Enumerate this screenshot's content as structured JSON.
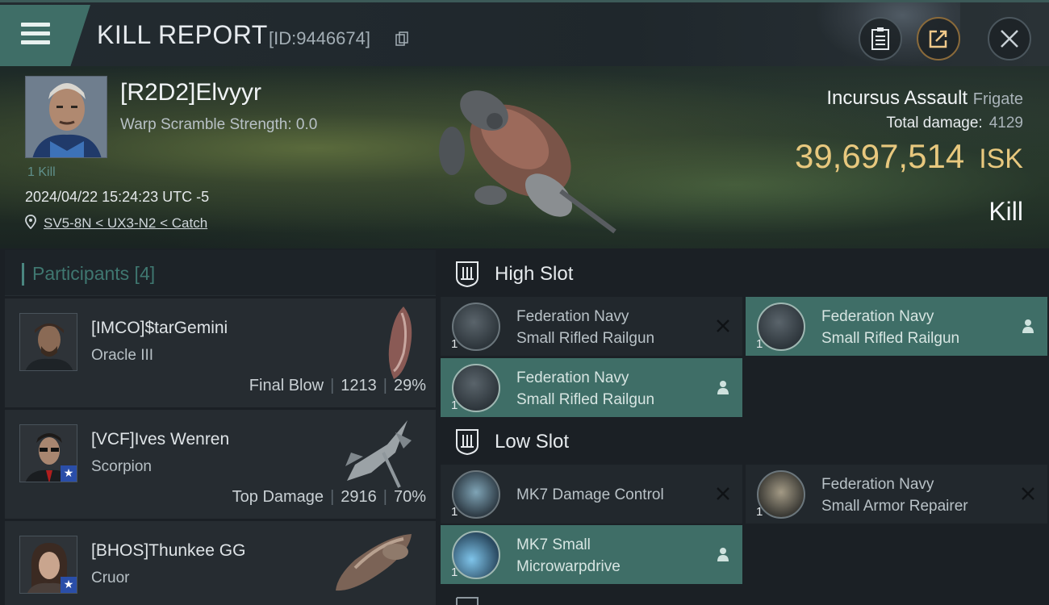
{
  "header": {
    "title": "KILL REPORT",
    "report_id": "[ID:9446674]"
  },
  "victim": {
    "name": "[R2D2]Elvyyr",
    "warp_scramble": "Warp Scramble Strength: 0.0",
    "kill_count": "1 Kill",
    "datetime": "2024/04/22 15:24:23 UTC -5",
    "location": "SV5-8N < UX3-N2 < Catch",
    "ship_name": "Incursus Assault",
    "ship_class": "Frigate",
    "total_damage_label": "Total damage:",
    "total_damage": "4129",
    "isk_value": "39,697,514",
    "isk_unit": "ISK",
    "result": "Kill"
  },
  "participants": {
    "label": "Participants [4]",
    "rows": [
      {
        "name": "[IMCO]$tarGemini",
        "ship": "Oracle III",
        "tag": "Final Blow",
        "damage": "1213",
        "percent": "29%"
      },
      {
        "name": "[VCF]Ives Wenren",
        "ship": "Scorpion",
        "tag": "Top Damage",
        "damage": "2916",
        "percent": "70%"
      },
      {
        "name": "[BHOS]Thunkee GG",
        "ship": "Cruor"
      }
    ]
  },
  "slots": {
    "high": {
      "label": "High Slot",
      "modules": [
        {
          "line1": "Federation Navy",
          "line2": "Small Rifled Railgun",
          "qty": "1",
          "state": "destroyed"
        },
        {
          "line1": "Federation Navy",
          "line2": "Small Rifled Railgun",
          "qty": "1",
          "state": "dropped"
        },
        {
          "line1": "Federation Navy",
          "line2": "Small Rifled Railgun",
          "qty": "1",
          "state": "dropped"
        }
      ]
    },
    "low": {
      "label": "Low Slot",
      "modules": [
        {
          "line1": "MK7 Damage Control",
          "line2": "",
          "qty": "1",
          "state": "destroyed"
        },
        {
          "line1": "Federation Navy",
          "line2": "Small Armor Repairer",
          "qty": "1",
          "state": "destroyed"
        },
        {
          "line1": "MK7 Small",
          "line2": "Microwarpdrive",
          "qty": "1",
          "state": "dropped"
        }
      ]
    }
  },
  "colors": {
    "accent_teal": "#3f6e67",
    "isk_gold": "#e8c87e",
    "panel": "#262c31"
  },
  "icons": [
    "menu-icon",
    "copy-icon",
    "clipboard-icon",
    "share-icon",
    "close-icon",
    "location-pin-icon",
    "high-slot-icon",
    "low-slot-icon",
    "destroyed-x-icon",
    "dropped-person-icon"
  ]
}
